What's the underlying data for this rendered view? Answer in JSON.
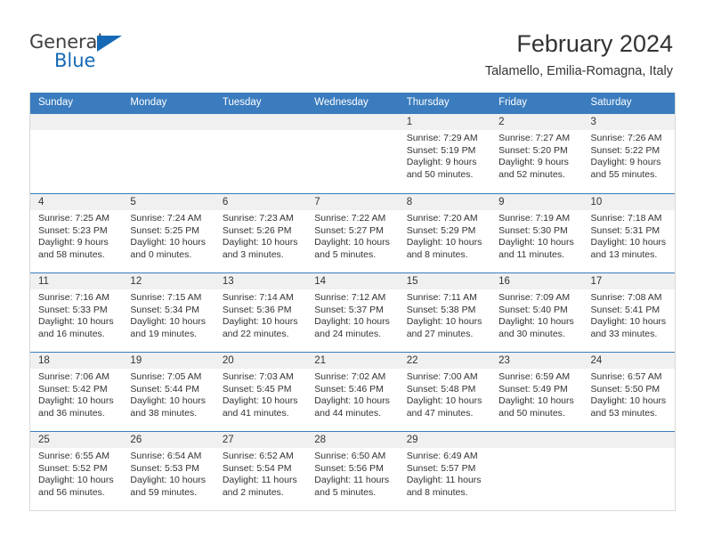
{
  "logo": {
    "word1": "General",
    "word2": "Blue",
    "triangle_color": "#1569b4"
  },
  "header": {
    "title": "February 2024",
    "subtitle": "Talamello, Emilia-Romagna, Italy"
  },
  "colors": {
    "header_blue": "#3a7cbe",
    "daynum_band": "#f0f0f0",
    "text": "#333333",
    "border": "#d8d8d8"
  },
  "weekdays": [
    "Sunday",
    "Monday",
    "Tuesday",
    "Wednesday",
    "Thursday",
    "Friday",
    "Saturday"
  ],
  "weeks": [
    [
      {
        "day": "",
        "lines": []
      },
      {
        "day": "",
        "lines": []
      },
      {
        "day": "",
        "lines": []
      },
      {
        "day": "",
        "lines": []
      },
      {
        "day": "1",
        "lines": [
          "Sunrise: 7:29 AM",
          "Sunset: 5:19 PM",
          "Daylight: 9 hours",
          "and 50 minutes."
        ]
      },
      {
        "day": "2",
        "lines": [
          "Sunrise: 7:27 AM",
          "Sunset: 5:20 PM",
          "Daylight: 9 hours",
          "and 52 minutes."
        ]
      },
      {
        "day": "3",
        "lines": [
          "Sunrise: 7:26 AM",
          "Sunset: 5:22 PM",
          "Daylight: 9 hours",
          "and 55 minutes."
        ]
      }
    ],
    [
      {
        "day": "4",
        "lines": [
          "Sunrise: 7:25 AM",
          "Sunset: 5:23 PM",
          "Daylight: 9 hours",
          "and 58 minutes."
        ]
      },
      {
        "day": "5",
        "lines": [
          "Sunrise: 7:24 AM",
          "Sunset: 5:25 PM",
          "Daylight: 10 hours",
          "and 0 minutes."
        ]
      },
      {
        "day": "6",
        "lines": [
          "Sunrise: 7:23 AM",
          "Sunset: 5:26 PM",
          "Daylight: 10 hours",
          "and 3 minutes."
        ]
      },
      {
        "day": "7",
        "lines": [
          "Sunrise: 7:22 AM",
          "Sunset: 5:27 PM",
          "Daylight: 10 hours",
          "and 5 minutes."
        ]
      },
      {
        "day": "8",
        "lines": [
          "Sunrise: 7:20 AM",
          "Sunset: 5:29 PM",
          "Daylight: 10 hours",
          "and 8 minutes."
        ]
      },
      {
        "day": "9",
        "lines": [
          "Sunrise: 7:19 AM",
          "Sunset: 5:30 PM",
          "Daylight: 10 hours",
          "and 11 minutes."
        ]
      },
      {
        "day": "10",
        "lines": [
          "Sunrise: 7:18 AM",
          "Sunset: 5:31 PM",
          "Daylight: 10 hours",
          "and 13 minutes."
        ]
      }
    ],
    [
      {
        "day": "11",
        "lines": [
          "Sunrise: 7:16 AM",
          "Sunset: 5:33 PM",
          "Daylight: 10 hours",
          "and 16 minutes."
        ]
      },
      {
        "day": "12",
        "lines": [
          "Sunrise: 7:15 AM",
          "Sunset: 5:34 PM",
          "Daylight: 10 hours",
          "and 19 minutes."
        ]
      },
      {
        "day": "13",
        "lines": [
          "Sunrise: 7:14 AM",
          "Sunset: 5:36 PM",
          "Daylight: 10 hours",
          "and 22 minutes."
        ]
      },
      {
        "day": "14",
        "lines": [
          "Sunrise: 7:12 AM",
          "Sunset: 5:37 PM",
          "Daylight: 10 hours",
          "and 24 minutes."
        ]
      },
      {
        "day": "15",
        "lines": [
          "Sunrise: 7:11 AM",
          "Sunset: 5:38 PM",
          "Daylight: 10 hours",
          "and 27 minutes."
        ]
      },
      {
        "day": "16",
        "lines": [
          "Sunrise: 7:09 AM",
          "Sunset: 5:40 PM",
          "Daylight: 10 hours",
          "and 30 minutes."
        ]
      },
      {
        "day": "17",
        "lines": [
          "Sunrise: 7:08 AM",
          "Sunset: 5:41 PM",
          "Daylight: 10 hours",
          "and 33 minutes."
        ]
      }
    ],
    [
      {
        "day": "18",
        "lines": [
          "Sunrise: 7:06 AM",
          "Sunset: 5:42 PM",
          "Daylight: 10 hours",
          "and 36 minutes."
        ]
      },
      {
        "day": "19",
        "lines": [
          "Sunrise: 7:05 AM",
          "Sunset: 5:44 PM",
          "Daylight: 10 hours",
          "and 38 minutes."
        ]
      },
      {
        "day": "20",
        "lines": [
          "Sunrise: 7:03 AM",
          "Sunset: 5:45 PM",
          "Daylight: 10 hours",
          "and 41 minutes."
        ]
      },
      {
        "day": "21",
        "lines": [
          "Sunrise: 7:02 AM",
          "Sunset: 5:46 PM",
          "Daylight: 10 hours",
          "and 44 minutes."
        ]
      },
      {
        "day": "22",
        "lines": [
          "Sunrise: 7:00 AM",
          "Sunset: 5:48 PM",
          "Daylight: 10 hours",
          "and 47 minutes."
        ]
      },
      {
        "day": "23",
        "lines": [
          "Sunrise: 6:59 AM",
          "Sunset: 5:49 PM",
          "Daylight: 10 hours",
          "and 50 minutes."
        ]
      },
      {
        "day": "24",
        "lines": [
          "Sunrise: 6:57 AM",
          "Sunset: 5:50 PM",
          "Daylight: 10 hours",
          "and 53 minutes."
        ]
      }
    ],
    [
      {
        "day": "25",
        "lines": [
          "Sunrise: 6:55 AM",
          "Sunset: 5:52 PM",
          "Daylight: 10 hours",
          "and 56 minutes."
        ]
      },
      {
        "day": "26",
        "lines": [
          "Sunrise: 6:54 AM",
          "Sunset: 5:53 PM",
          "Daylight: 10 hours",
          "and 59 minutes."
        ]
      },
      {
        "day": "27",
        "lines": [
          "Sunrise: 6:52 AM",
          "Sunset: 5:54 PM",
          "Daylight: 11 hours",
          "and 2 minutes."
        ]
      },
      {
        "day": "28",
        "lines": [
          "Sunrise: 6:50 AM",
          "Sunset: 5:56 PM",
          "Daylight: 11 hours",
          "and 5 minutes."
        ]
      },
      {
        "day": "29",
        "lines": [
          "Sunrise: 6:49 AM",
          "Sunset: 5:57 PM",
          "Daylight: 11 hours",
          "and 8 minutes."
        ]
      },
      {
        "day": "",
        "lines": []
      },
      {
        "day": "",
        "lines": []
      }
    ]
  ]
}
